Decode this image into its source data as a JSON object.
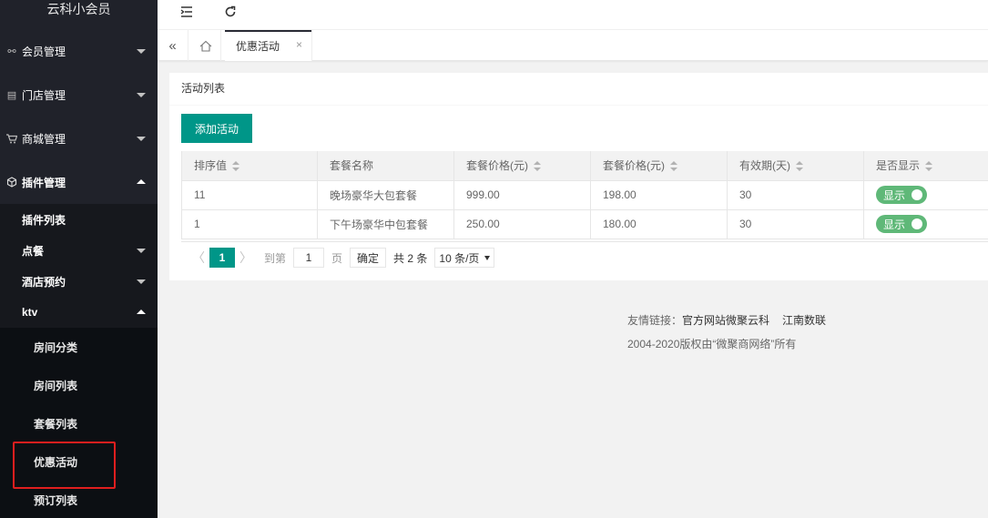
{
  "brand": "云科小会员",
  "sidebar": {
    "items": [
      {
        "label": "会员管理",
        "icon": "link-icon"
      },
      {
        "label": "门店管理",
        "icon": "store-icon"
      },
      {
        "label": "商城管理",
        "icon": "cart-icon"
      },
      {
        "label": "插件管理",
        "icon": "cube-icon"
      }
    ],
    "plugin_sub": [
      {
        "label": "插件列表"
      },
      {
        "label": "点餐"
      },
      {
        "label": "酒店预约"
      },
      {
        "label": "ktv"
      }
    ],
    "ktv_sub": [
      {
        "label": "房间分类"
      },
      {
        "label": "房间列表"
      },
      {
        "label": "套餐列表"
      },
      {
        "label": "优惠活动"
      },
      {
        "label": "预订列表"
      }
    ]
  },
  "tabs": {
    "active": "优惠活动",
    "close_symbol": "×"
  },
  "card": {
    "title": "活动列表",
    "add_button": "添加活动"
  },
  "table": {
    "headers": [
      "排序值",
      "套餐名称",
      "套餐价格(元)",
      "套餐价格(元)",
      "有效期(天)",
      "是否显示"
    ],
    "rows": [
      [
        "11",
        "晚场豪华大包套餐",
        "999.00",
        "198.00",
        "30",
        "显示"
      ],
      [
        "1",
        "下午场豪华中包套餐",
        "250.00",
        "180.00",
        "30",
        "显示"
      ]
    ]
  },
  "pager": {
    "prev": "〈",
    "current": "1",
    "next": "〉",
    "goto_prefix": "到第",
    "goto_value": "1",
    "goto_suffix": "页",
    "confirm": "确定",
    "total": "共 2 条",
    "page_size": "10 条/页"
  },
  "footer": {
    "links_label": "友情链接：",
    "links": [
      "官方网站微聚云科",
      "江南数联"
    ],
    "copyright": "2004-2020版权由“微聚商网络”所有"
  },
  "colors": {
    "sidebar_bg": "#20222a",
    "accent": "#009688",
    "switch_on": "#5fb878",
    "highlight": "#e01e1e"
  }
}
